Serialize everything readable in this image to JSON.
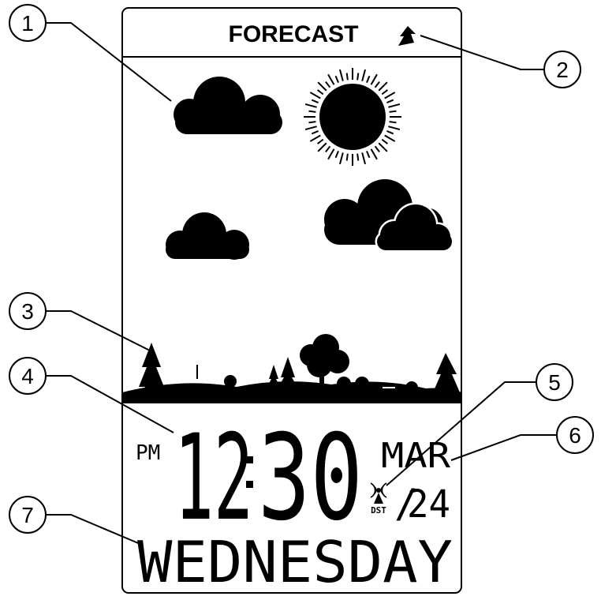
{
  "header": {
    "title": "FORECAST"
  },
  "display": {
    "ampm": "PM",
    "hours": "12",
    "minutes": "30",
    "month": "MAR",
    "day": "24",
    "dst_label": "DST",
    "weekday": "WEDNESDAY"
  },
  "callouts": [
    "1",
    "2",
    "3",
    "4",
    "5",
    "6",
    "7"
  ],
  "icons": {
    "trend": "up-arrow-icon",
    "signal": "radio-signal-icon"
  }
}
